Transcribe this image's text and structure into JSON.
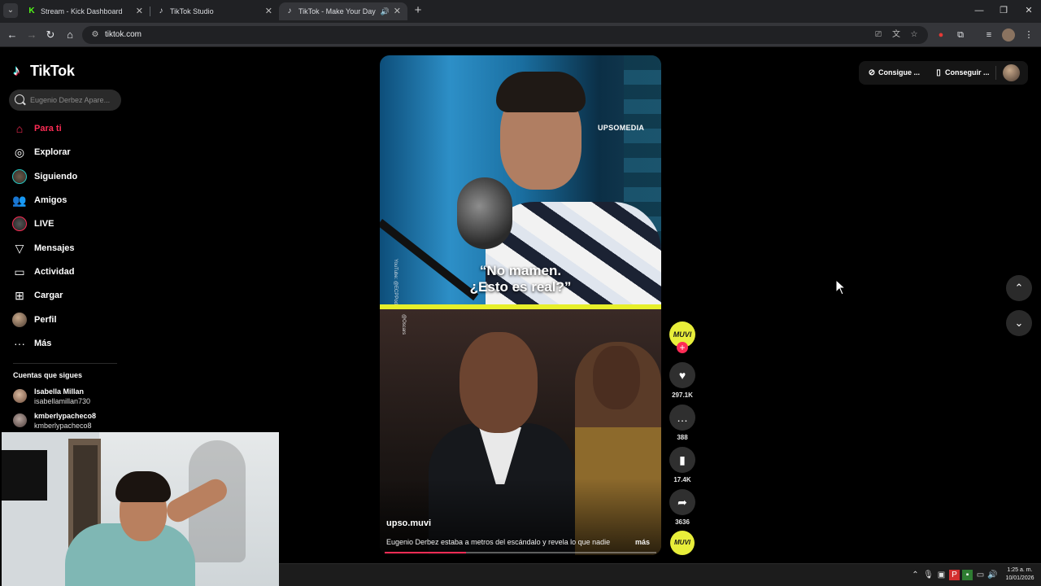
{
  "browser": {
    "tabs": [
      {
        "title": "Stream - Kick Dashboard",
        "icon": "kick-icon",
        "active": false
      },
      {
        "title": "TikTok Studio",
        "icon": "tiktok-icon",
        "active": false
      },
      {
        "title": "TikTok - Make Your Day",
        "icon": "tiktok-icon",
        "active": true
      }
    ],
    "url": "tiktok.com"
  },
  "sidebar": {
    "logo_text": "TikTok",
    "search_placeholder": "Eugenio Derbez Apare...",
    "nav": [
      {
        "label": "Para ti",
        "icon": "home-icon",
        "active": true
      },
      {
        "label": "Explorar",
        "icon": "compass-icon"
      },
      {
        "label": "Siguiendo",
        "icon": "following-avatar-icon"
      },
      {
        "label": "Amigos",
        "icon": "friends-icon"
      },
      {
        "label": "LIVE",
        "icon": "live-avatar-icon"
      },
      {
        "label": "Mensajes",
        "icon": "send-icon"
      },
      {
        "label": "Actividad",
        "icon": "activity-icon"
      },
      {
        "label": "Cargar",
        "icon": "upload-icon"
      },
      {
        "label": "Perfil",
        "icon": "profile-icon"
      },
      {
        "label": "Más",
        "icon": "more-icon"
      }
    ],
    "following_header": "Cuentas que sigues",
    "following": [
      {
        "name": "Isabella Millan",
        "username": "isabellamillan730"
      },
      {
        "name": "kmberlypacheco8",
        "username": "kmberlypacheco8"
      }
    ]
  },
  "video": {
    "brand_watermark": "UPSOMEDIA",
    "caption_line1": "“No mamen.",
    "caption_line2": "¿Esto es real?”",
    "credit_top": "YouTube: @ECPPodcast",
    "credit_bottom": "@Oscars",
    "author": "upso.muvi",
    "description": "Eugenio Derbez estaba a metros del escándalo y revela lo que nadie",
    "more_label": "más",
    "progress": 0.3
  },
  "actions": {
    "avatar_text": "MUVI",
    "likes": "297.1K",
    "comments": "388",
    "saves": "17.4K",
    "shares": "3636",
    "music_text": "MUVI"
  },
  "top_actions": {
    "coins_label": "Consigue ...",
    "app_label": "Conseguir ..."
  },
  "taskbar": {
    "time": "1:25 a. m.",
    "date": "10/01/2026"
  },
  "colors": {
    "accent": "#fe2c55",
    "background": "#000000",
    "video_split": "#e7ef2a"
  }
}
